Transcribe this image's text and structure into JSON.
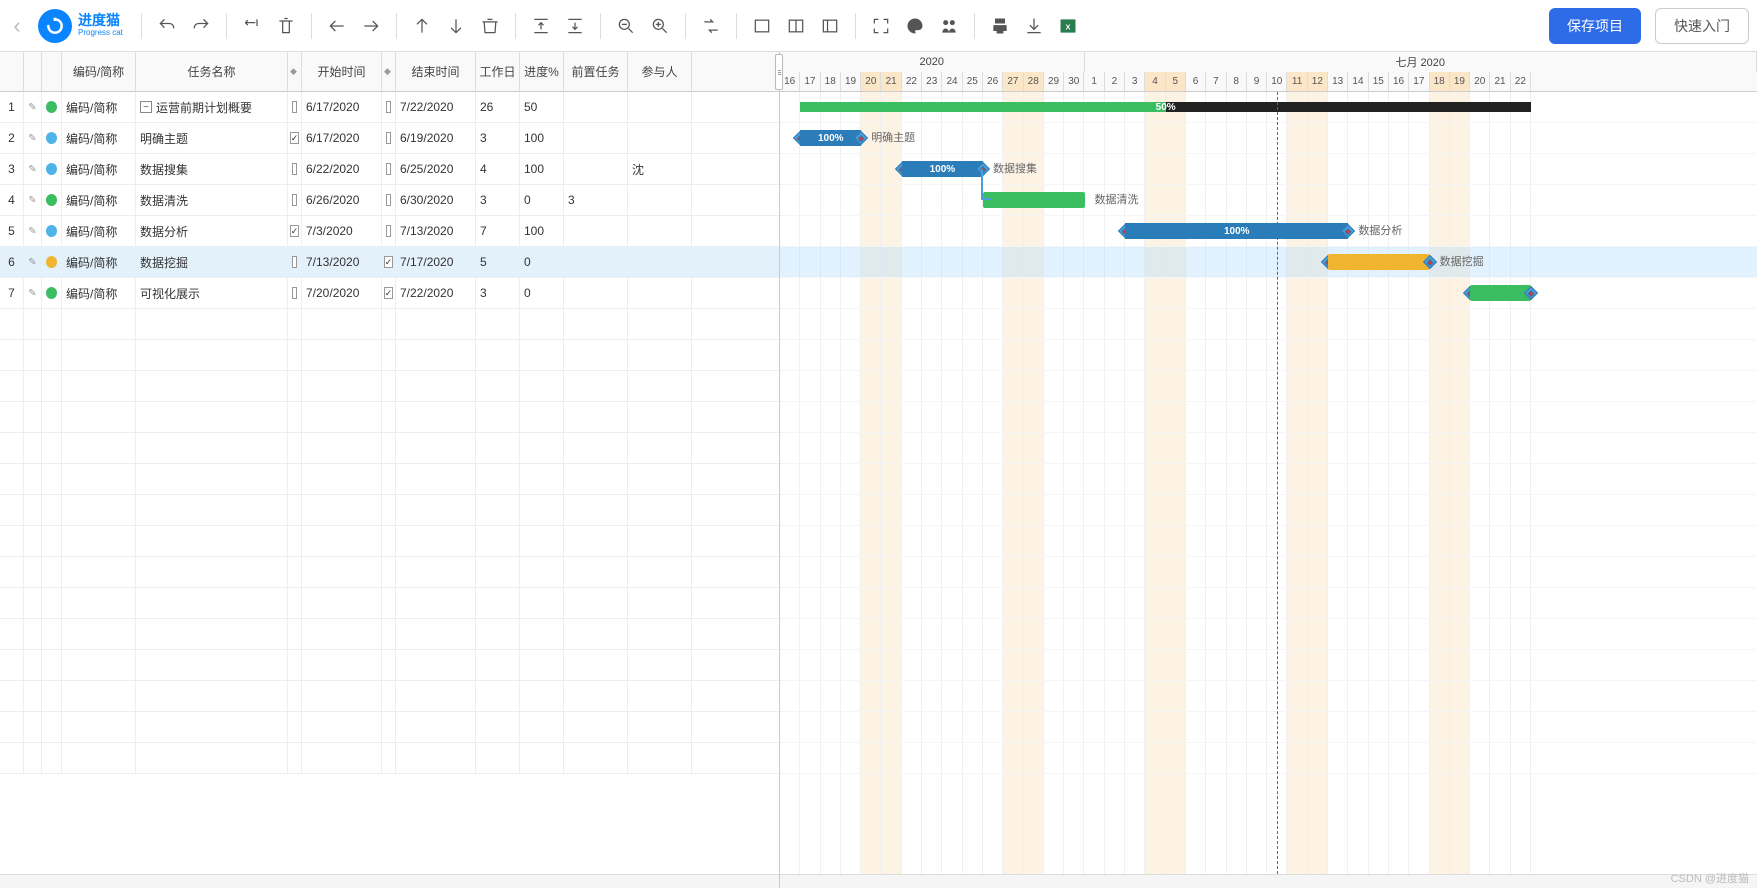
{
  "brand": {
    "cn": "进度猫",
    "en": "Progress cat"
  },
  "toolbar": {
    "save_label": "保存项目",
    "quickstart_label": "快速入门"
  },
  "columns": {
    "code": "编码/简称",
    "task_name": "任务名称",
    "start": "开始时间",
    "end": "结束时间",
    "workdays": "工作日",
    "progress": "进度%",
    "predecessors": "前置任务",
    "participants": "参与人"
  },
  "tasks": [
    {
      "num": 1,
      "color": "#3bbd62",
      "code": "编码/简称",
      "name": "运营前期计划概要",
      "is_parent": true,
      "start": "6/17/2020",
      "end": "7/22/2020",
      "end_dim": true,
      "wd": "26",
      "wd_dim": true,
      "pct": "50",
      "pct_dim": true,
      "pred": "",
      "part": "",
      "start_chk": false,
      "end_chk": false
    },
    {
      "num": 2,
      "color": "#4fb3e8",
      "code": "编码/简称",
      "name": "明确主题",
      "indent": true,
      "start": "6/17/2020",
      "end": "6/19/2020",
      "wd": "3",
      "pct": "100",
      "pred": "",
      "part": "",
      "start_chk": true,
      "end_chk": false
    },
    {
      "num": 3,
      "color": "#4fb3e8",
      "code": "编码/简称",
      "name": "数据搜集",
      "indent": true,
      "start": "6/22/2020",
      "end": "6/25/2020",
      "wd": "4",
      "pct": "100",
      "pred": "",
      "part": "沈",
      "start_chk": false,
      "end_chk": false
    },
    {
      "num": 4,
      "color": "#3bbd62",
      "code": "编码/简称",
      "name": "数据清洗",
      "indent": true,
      "start": "6/26/2020",
      "start_dim": true,
      "end": "6/30/2020",
      "wd": "3",
      "pct": "0",
      "pred": "3",
      "part": "",
      "start_chk": false,
      "end_chk": false
    },
    {
      "num": 5,
      "color": "#4fb3e8",
      "code": "编码/简称",
      "name": "数据分析",
      "indent": true,
      "start": "7/3/2020",
      "end": "7/13/2020",
      "wd": "7",
      "pct": "100",
      "pred": "",
      "part": "",
      "start_chk": true,
      "end_chk": false
    },
    {
      "num": 6,
      "color": "#f0b430",
      "code": "编码/简称",
      "name": "数据挖掘",
      "indent": true,
      "start": "7/13/2020",
      "end": "7/17/2020",
      "wd": "5",
      "pct": "0",
      "pred": "",
      "part": "",
      "start_chk": false,
      "end_chk": true,
      "selected": true
    },
    {
      "num": 7,
      "color": "#3bbd62",
      "code": "编码/简称",
      "name": "可视化展示",
      "indent": true,
      "start": "7/20/2020",
      "end": "7/22/2020",
      "wd": "3",
      "pct": "0",
      "pred": "",
      "part": "",
      "start_chk": false,
      "end_chk": true
    }
  ],
  "timeline": {
    "month_left_label": "2020",
    "month_right_label": "七月 2020",
    "days": [
      {
        "d": "16"
      },
      {
        "d": "17"
      },
      {
        "d": "18"
      },
      {
        "d": "19"
      },
      {
        "d": "20",
        "wk": true
      },
      {
        "d": "21",
        "wk": true
      },
      {
        "d": "22"
      },
      {
        "d": "23"
      },
      {
        "d": "24"
      },
      {
        "d": "25"
      },
      {
        "d": "26"
      },
      {
        "d": "27",
        "wk": true
      },
      {
        "d": "28",
        "wk": true
      },
      {
        "d": "29"
      },
      {
        "d": "30"
      },
      {
        "d": "1"
      },
      {
        "d": "2"
      },
      {
        "d": "3"
      },
      {
        "d": "4",
        "wk": true
      },
      {
        "d": "5",
        "wk": true
      },
      {
        "d": "6"
      },
      {
        "d": "7"
      },
      {
        "d": "8"
      },
      {
        "d": "9"
      },
      {
        "d": "10"
      },
      {
        "d": "11",
        "wk": true
      },
      {
        "d": "12",
        "wk": true
      },
      {
        "d": "13"
      },
      {
        "d": "14"
      },
      {
        "d": "15"
      },
      {
        "d": "16"
      },
      {
        "d": "17"
      },
      {
        "d": "18",
        "wk": true
      },
      {
        "d": "19",
        "wk": true
      },
      {
        "d": "20"
      },
      {
        "d": "21"
      },
      {
        "d": "22"
      }
    ],
    "today_index": 24
  },
  "chart_data": {
    "type": "gantt",
    "unit": "day",
    "start_date": "2020-06-16",
    "bars": [
      {
        "task": 1,
        "type": "summary",
        "start": "2020-06-17",
        "end": "2020-07-22",
        "progress": 50,
        "label": "50%"
      },
      {
        "task": 2,
        "type": "task",
        "color": "blue",
        "start": "2020-06-17",
        "end": "2020-06-19",
        "progress": 100,
        "label": "明确主题",
        "pct_label": "100%"
      },
      {
        "task": 3,
        "type": "task",
        "color": "blue",
        "start": "2020-06-22",
        "end": "2020-06-25",
        "progress": 100,
        "label": "数据搜集",
        "pct_label": "100%"
      },
      {
        "task": 4,
        "type": "task",
        "color": "green",
        "start": "2020-06-26",
        "end": "2020-06-30",
        "progress": 0,
        "label": "数据清洗"
      },
      {
        "task": 5,
        "type": "task",
        "color": "blue",
        "start": "2020-07-03",
        "end": "2020-07-13",
        "progress": 100,
        "label": "数据分析",
        "pct_label": "100%"
      },
      {
        "task": 6,
        "type": "task",
        "color": "orange",
        "start": "2020-07-13",
        "end": "2020-07-17",
        "progress": 0,
        "label": "数据挖掘"
      },
      {
        "task": 7,
        "type": "task",
        "color": "green",
        "start": "2020-07-20",
        "end": "2020-07-22",
        "progress": 0,
        "label": ""
      }
    ],
    "links": [
      {
        "from": 3,
        "to": 4,
        "type": "finish-to-start"
      }
    ]
  },
  "watermark": "CSDN @进度猫"
}
